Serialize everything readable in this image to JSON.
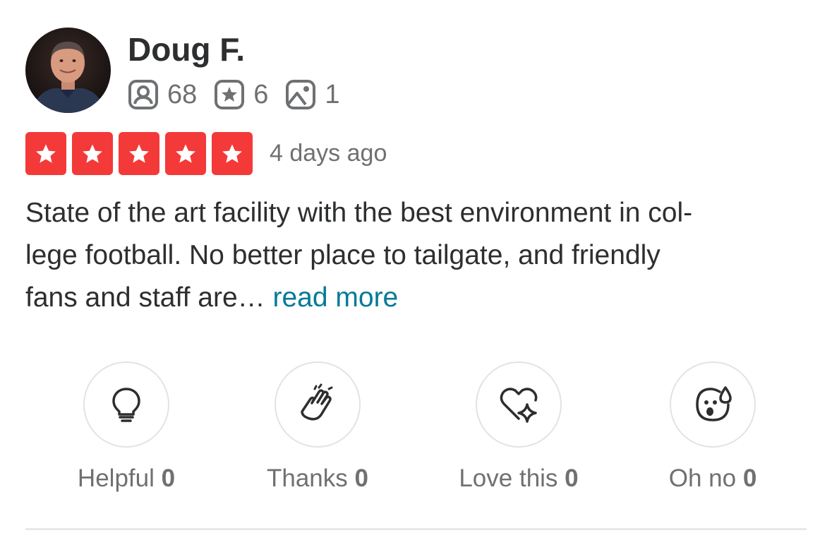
{
  "user": {
    "name": "Doug F.",
    "avatar_icon": "user-avatar-photo",
    "stats": {
      "friends": "68",
      "reviews": "6",
      "photos": "1"
    }
  },
  "review": {
    "rating": 5,
    "rating_max": 5,
    "rating_color": "#f43939",
    "date": "4 days ago",
    "text_lines": [
      "State of the art facility with the best environment in col-",
      "lege football. No better place to tailgate, and friendly",
      "fans and staff are…"
    ],
    "read_more": "read more",
    "link_color": "#027a97"
  },
  "reactions": [
    {
      "label": "Helpful",
      "count": "0",
      "icon": "lightbulb-icon"
    },
    {
      "label": "Thanks",
      "count": "0",
      "icon": "high-five-icon"
    },
    {
      "label": "Love this",
      "count": "0",
      "icon": "heart-sparkle-icon"
    },
    {
      "label": "Oh no",
      "count": "0",
      "icon": "surprised-face-icon"
    }
  ]
}
